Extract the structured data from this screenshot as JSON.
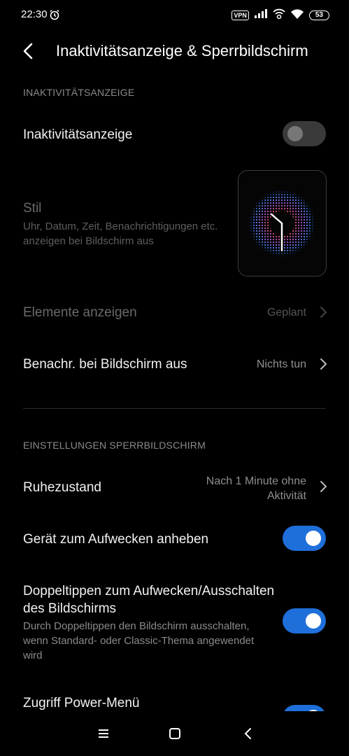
{
  "status_bar": {
    "time": "22:30",
    "vpn": "VPN",
    "battery": "53",
    "icons": [
      "alarm-icon",
      "signal-icon",
      "wifi-calling-icon",
      "wifi-icon",
      "battery-icon"
    ]
  },
  "header": {
    "title": "Inaktivitätsanzeige & Sperrbildschirm",
    "back_icon": "back-arrow-icon"
  },
  "section_inactivity": {
    "label": "INAKTIVITÄTSANZEIGE",
    "toggle_row": {
      "title": "Inaktivitätsanzeige",
      "enabled": false
    },
    "style_row": {
      "title": "Stil",
      "subtitle": "Uhr, Datum, Zeit, Benachrichtigungen etc. anzeigen bei Bildschirm aus"
    },
    "elements_row": {
      "title": "Elemente anzeigen",
      "value": "Geplant"
    },
    "notify_row": {
      "title": "Benachr. bei Bildschirm aus",
      "value": "Nichts tun"
    }
  },
  "section_lock": {
    "label": "EINSTELLUNGEN SPERRBILDSCHIRM",
    "sleep_row": {
      "title": "Ruhezustand",
      "value_line1": "Nach 1 Minute ohne",
      "value_line2": "Aktivität"
    },
    "lift_row": {
      "title": "Gerät zum Aufwecken anheben",
      "enabled": true
    },
    "doubletap_row": {
      "title_line1": "Doppeltippen zum Aufwecken/Ausschalten",
      "title_line2": "des Bildschirms",
      "subtitle": "Durch Doppeltippen den Bildschirm ausschalten, wenn Standard- oder Classic-Thema angewendet wird",
      "enabled": true
    },
    "power_row": {
      "title": "Zugriff Power-Menü",
      "enabled": true
    }
  },
  "nav_bar": {
    "icons": [
      "menu-icon",
      "home-icon",
      "back-icon"
    ]
  },
  "colors": {
    "accent": "#1e6fd9",
    "background": "#000000"
  }
}
